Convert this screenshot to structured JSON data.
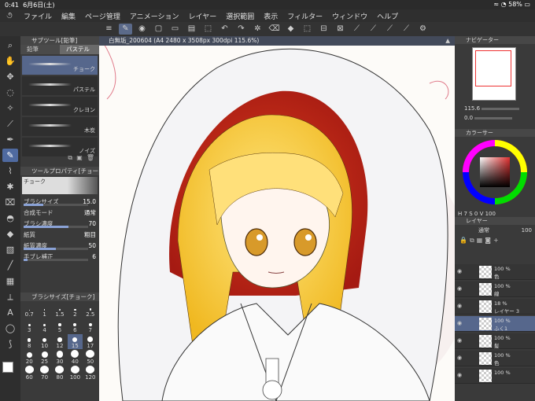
{
  "status": {
    "time": "0:41",
    "date": "6月6日(土)",
    "battery": "58%"
  },
  "menu": [
    "ファイル",
    "編集",
    "ページ管理",
    "アニメーション",
    "レイヤー",
    "選択範囲",
    "表示",
    "フィルター",
    "ウィンドウ",
    "ヘルプ"
  ],
  "subtool": {
    "title": "サブツール[鉛筆]",
    "tabs": [
      "鉛筆",
      "パステル"
    ],
    "brushes": [
      "チョーク",
      "パステル",
      "クレヨン",
      "木炭",
      "ノイズ"
    ]
  },
  "toolprop": {
    "title": "ツールプロパティ[チョーク]",
    "preset": "チョーク",
    "rows": [
      {
        "label": "ブラシサイズ",
        "value": "15.0",
        "fill": 0.3
      },
      {
        "label": "合成モード",
        "value": "通常",
        "fill": null
      },
      {
        "label": "ブラシ濃度",
        "value": "70",
        "fill": 0.7
      },
      {
        "label": "紙質",
        "value": "粗目",
        "fill": null
      },
      {
        "label": "紙質濃度",
        "value": "50",
        "fill": 0.5
      },
      {
        "label": "手ブレ補正",
        "value": "6",
        "fill": 0.06
      }
    ]
  },
  "brushsize": {
    "title": "ブラシサイズ[チョーク]",
    "sizes": [
      "0.7",
      "1",
      "1.5",
      "2",
      "2.5",
      "3",
      "4",
      "5",
      "6",
      "7",
      "8",
      "10",
      "12",
      "15",
      "17",
      "20",
      "25",
      "30",
      "40",
      "50",
      "60",
      "70",
      "80",
      "100",
      "120"
    ],
    "selected": "15"
  },
  "canvas": {
    "tab": "白無垢_200604 (A4 2480 x 3508px 300dpi 115.6%)"
  },
  "navigator": {
    "title": "ナビゲーター",
    "zoom": "115.6",
    "angle": "0.0"
  },
  "color": {
    "title": "カラーサー",
    "h": "7",
    "s": "0",
    "v": "100"
  },
  "layers": {
    "title": "レイヤー",
    "mode": "通常",
    "opacity": "100",
    "items": [
      {
        "pct": "100 %",
        "name": "色",
        "selected": false
      },
      {
        "pct": "100 %",
        "name": "線",
        "selected": false
      },
      {
        "pct": "18 %",
        "name": "レイヤー 3",
        "selected": false
      },
      {
        "pct": "100 %",
        "name": "ふく1",
        "selected": true
      },
      {
        "pct": "100 %",
        "name": "髪",
        "selected": false
      },
      {
        "pct": "100 %",
        "name": "色",
        "selected": false
      },
      {
        "pct": "100 %",
        "name": "",
        "selected": false
      }
    ]
  }
}
